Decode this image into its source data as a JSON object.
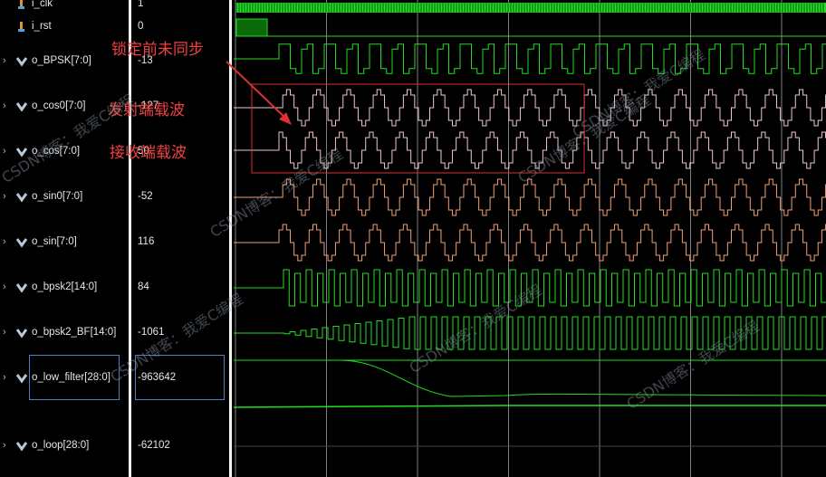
{
  "signals": [
    {
      "name": "i_clk",
      "value": "1",
      "bus": false,
      "kind": "bit"
    },
    {
      "name": "i_rst",
      "value": "0",
      "bus": false,
      "kind": "bit"
    },
    {
      "name": "o_BPSK[7:0]",
      "value": "-13",
      "bus": true
    },
    {
      "name": "o_cos0[7:0]",
      "value": "-127",
      "bus": true
    },
    {
      "name": "o_cos[7:0]",
      "value": "50",
      "bus": true
    },
    {
      "name": "o_sin0[7:0]",
      "value": "-52",
      "bus": true
    },
    {
      "name": "o_sin[7:0]",
      "value": "116",
      "bus": true
    },
    {
      "name": "o_bpsk2[14:0]",
      "value": "84",
      "bus": true
    },
    {
      "name": "o_bpsk2_BF[14:0]",
      "value": "-1061",
      "bus": true
    },
    {
      "name": "o_low_filter[28:0]",
      "value": "-963642",
      "bus": true
    },
    {
      "name": "o_loop[28:0]",
      "value": "-62102",
      "bus": true
    }
  ],
  "annotations": {
    "lock_note": "锁定前未同步",
    "tx_carrier": "发射端载波",
    "rx_carrier": "接收端载波"
  },
  "watermark": "CSDN博客：我爱C编程",
  "colors": {
    "green": "#22dd22",
    "pink": "#f0c8c8",
    "orange": "#f0a070",
    "red": "#e03030",
    "selection": "#4f7fbf"
  }
}
